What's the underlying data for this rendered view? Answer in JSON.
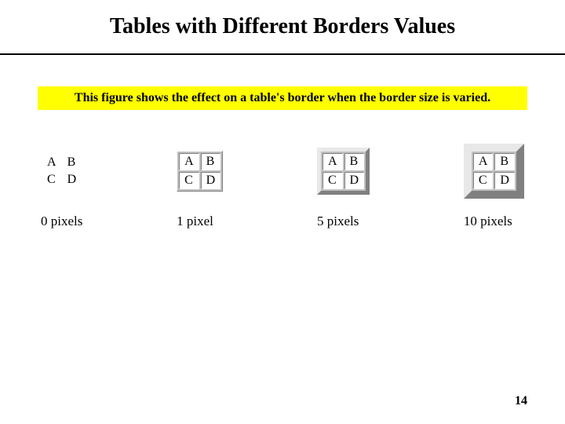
{
  "title": "Tables with Different Borders Values",
  "caption": "This figure shows the effect on a table's border when the border size is varied.",
  "examples": [
    {
      "border": 0,
      "label": "0 pixels",
      "cells": [
        [
          "A",
          "B"
        ],
        [
          "C",
          "D"
        ]
      ]
    },
    {
      "border": 1,
      "label": "1 pixel",
      "cells": [
        [
          "A",
          "B"
        ],
        [
          "C",
          "D"
        ]
      ]
    },
    {
      "border": 5,
      "label": "5 pixels",
      "cells": [
        [
          "A",
          "B"
        ],
        [
          "C",
          "D"
        ]
      ]
    },
    {
      "border": 10,
      "label": "10 pixels",
      "cells": [
        [
          "A",
          "B"
        ],
        [
          "C",
          "D"
        ]
      ]
    }
  ],
  "page_number": "14"
}
